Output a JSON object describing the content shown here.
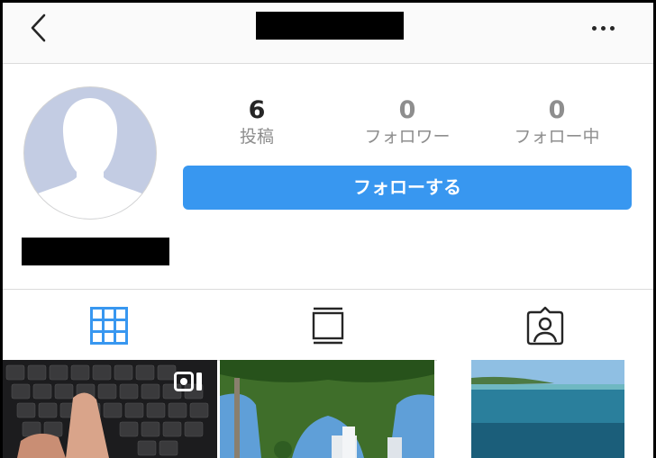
{
  "profile": {
    "stats": [
      {
        "value": "6",
        "label": "投稿"
      },
      {
        "value": "0",
        "label": "フォロワー"
      },
      {
        "value": "0",
        "label": "フォロー中"
      }
    ],
    "follow_button": "フォローする"
  },
  "icons": {
    "back": "back-arrow-icon",
    "more": "more-options-icon",
    "grid": "grid-icon",
    "feed": "feed-icon",
    "tagged": "tagged-icon",
    "video": "video-icon"
  },
  "colors": {
    "accent": "#3897f0",
    "count": "#262626",
    "zero_count": "#8e8e8e"
  }
}
